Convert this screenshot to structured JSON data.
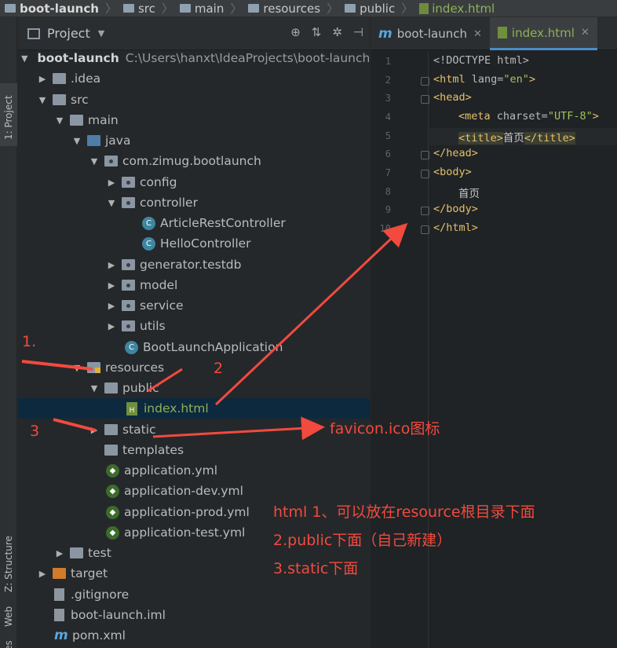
{
  "breadcrumb": [
    "boot-launch",
    "src",
    "main",
    "resources",
    "public",
    "index.html"
  ],
  "left_strip": {
    "project_tab": "1: Project",
    "structure_tab": "Z: Structure",
    "web_tab": "Web",
    "favorites_tab": "rites"
  },
  "project_panel": {
    "title": "Project",
    "tree": [
      {
        "label": "boot-launch",
        "path": "C:\\Users\\hanxt\\IdeaProjects\\boot-launch"
      },
      {
        "label": ".idea"
      },
      {
        "label": "src"
      },
      {
        "label": "main"
      },
      {
        "label": "java"
      },
      {
        "label": "com.zimug.bootlaunch"
      },
      {
        "label": "config"
      },
      {
        "label": "controller"
      },
      {
        "label": "ArticleRestController"
      },
      {
        "label": "HelloController"
      },
      {
        "label": "generator.testdb"
      },
      {
        "label": "model"
      },
      {
        "label": "service"
      },
      {
        "label": "utils"
      },
      {
        "label": "BootLaunchApplication"
      },
      {
        "label": "resources"
      },
      {
        "label": "public"
      },
      {
        "label": "index.html"
      },
      {
        "label": "static"
      },
      {
        "label": "templates"
      },
      {
        "label": "application.yml"
      },
      {
        "label": "application-dev.yml"
      },
      {
        "label": "application-prod.yml"
      },
      {
        "label": "application-test.yml"
      },
      {
        "label": "test"
      },
      {
        "label": "target"
      },
      {
        "label": ".gitignore"
      },
      {
        "label": "boot-launch.iml"
      },
      {
        "label": "pom.xml"
      }
    ]
  },
  "editor": {
    "tabs": [
      {
        "label": "boot-launch"
      },
      {
        "label": "index.html"
      }
    ],
    "line_numbers": [
      "1",
      "2",
      "3",
      "4",
      "5",
      "6",
      "7",
      "8",
      "9",
      "10"
    ],
    "code": {
      "l1": "<!DOCTYPE html>",
      "l2_tag": "<html ",
      "l2_attr": "lang=",
      "l2_val": "\"en\"",
      "l2_end": ">",
      "l3": "<head>",
      "l4_tag": "<meta ",
      "l4_attr": "charset=",
      "l4_val": "\"UTF-8\"",
      "l4_end": ">",
      "l5_open": "<title>",
      "l5_text": "首页",
      "l5_close": "</title>",
      "l6": "</head>",
      "l7": "<body>",
      "l8": "首页",
      "l9": "</body>",
      "l10": "</html>"
    }
  },
  "annotations": {
    "n1": "1.",
    "n2": "2",
    "n3": "3",
    "favicon": "favicon.ico图标",
    "note1": "html   1、可以放在resource根目录下面",
    "note2": "2.public下面（自己新建）",
    "note3": "3.static下面"
  },
  "colors": {
    "annotation_red": "#f24a3e",
    "selection": "#0d293e",
    "html_green": "#8fb05a"
  }
}
